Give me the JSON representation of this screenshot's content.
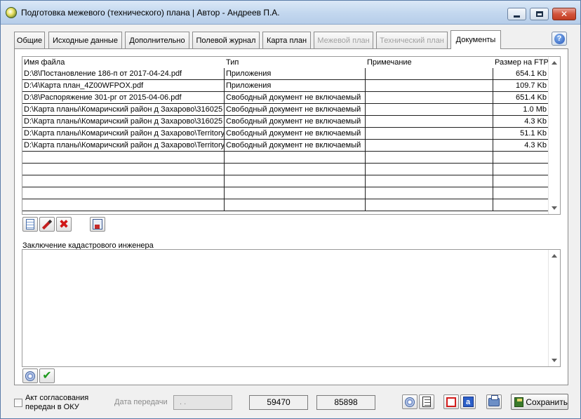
{
  "window": {
    "title": "Подготовка межевого (технического) плана | Автор - Андреев П.А.",
    "close_glyph": "✕"
  },
  "tabs": [
    {
      "label": "Общие",
      "state": "normal"
    },
    {
      "label": "Исходные данные",
      "state": "normal"
    },
    {
      "label": "Дополнительно",
      "state": "normal"
    },
    {
      "label": "Полевой журнал",
      "state": "normal"
    },
    {
      "label": "Карта план",
      "state": "normal"
    },
    {
      "label": "Межевой план",
      "state": "disabled"
    },
    {
      "label": "Технический план",
      "state": "disabled"
    },
    {
      "label": "Документы",
      "state": "active"
    }
  ],
  "help_glyph": "?",
  "documents": {
    "columns": {
      "file": "Имя файла",
      "type": "Тип",
      "note": "Примечание",
      "size": "Размер на FTP"
    },
    "rows": [
      {
        "file": "D:\\8\\Постановление 186-п от 2017-04-24.pdf",
        "type": "Приложения",
        "note": "",
        "size": "654.1 Kb"
      },
      {
        "file": "D:\\4\\Карта план_4Z00WFPOX.pdf",
        "type": "Приложения",
        "note": "",
        "size": "109.7 Kb"
      },
      {
        "file": "D:\\8\\Распоряжение 301-рг от 2015-04-06.pdf",
        "type": "Свободный документ не включаемый",
        "note": "",
        "size": "651.4 Kb"
      },
      {
        "file": "D:\\Карта планы\\Комаричский район д Захарово\\316025",
        "type": "Свободный документ не включаемый",
        "note": "",
        "size": "1.0 Mb"
      },
      {
        "file": "D:\\Карта планы\\Комаричский район д Захарово\\316025",
        "type": "Свободный документ не включаемый",
        "note": "",
        "size": "4.3 Kb"
      },
      {
        "file": "D:\\Карта планы\\Комаричский район д Захарово\\Territory",
        "type": "Свободный документ не включаемый",
        "note": "",
        "size": "51.1 Kb"
      },
      {
        "file": "D:\\Карта планы\\Комаричский район д Захарово\\Territory",
        "type": "Свободный документ не включаемый",
        "note": "",
        "size": "4.3 Kb"
      },
      {
        "file": "",
        "type": "",
        "note": "",
        "size": ""
      },
      {
        "file": "",
        "type": "",
        "note": "",
        "size": ""
      },
      {
        "file": "",
        "type": "",
        "note": "",
        "size": ""
      },
      {
        "file": "",
        "type": "",
        "note": "",
        "size": ""
      },
      {
        "file": "",
        "type": "",
        "note": "",
        "size": ""
      }
    ]
  },
  "conclusion": {
    "label": "Заключение кадастрового инженера",
    "value": ""
  },
  "footer": {
    "act_label": "Акт согласования передан в ОКУ",
    "act_checked": false,
    "date_label": "Дата передачи",
    "date_value": " . .",
    "number1": "59470",
    "number2": "85898",
    "blue_a_glyph": "a",
    "save_label": "Сохранить"
  },
  "cross_glyph": "✖",
  "check_glyph": "✔"
}
